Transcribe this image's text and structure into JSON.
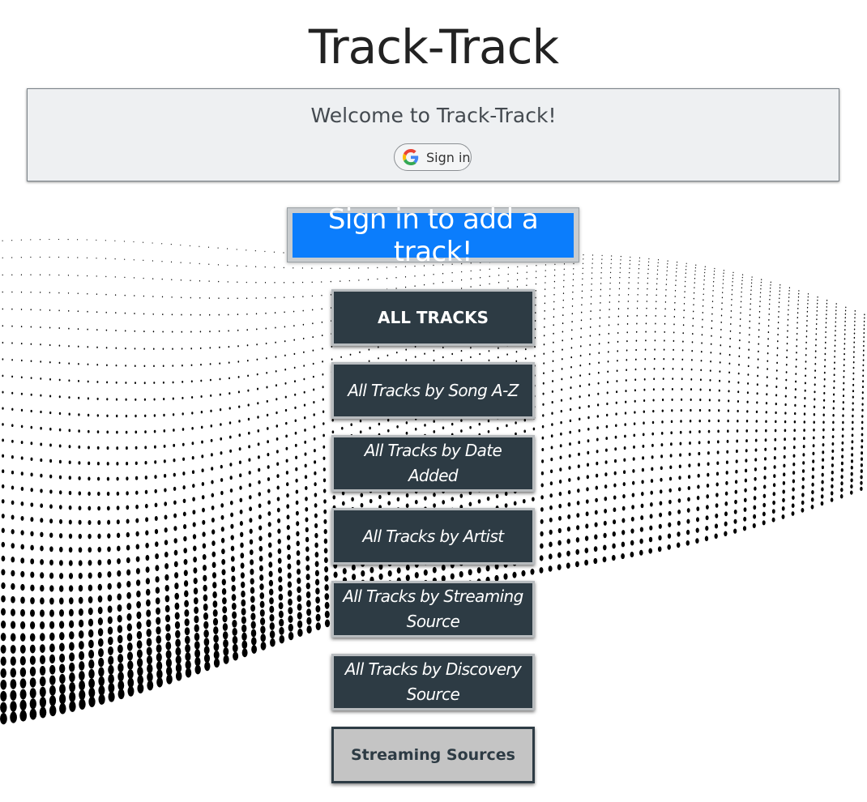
{
  "header": {
    "title": "Track-Track"
  },
  "welcome": {
    "message": "Welcome to Track-Track!",
    "google_signin_label": "Sign in",
    "google_icon": "google-g-icon"
  },
  "add_track": {
    "label": "Sign in to add a track!"
  },
  "nav": {
    "buttons": [
      {
        "label": "ALL TRACKS"
      },
      {
        "label": "All Tracks by Song A-Z"
      },
      {
        "label": "All Tracks by Date Added"
      },
      {
        "label": "All Tracks by Artist"
      },
      {
        "label": "All Tracks by Streaming Source"
      },
      {
        "label": "All Tracks by Discovery Source"
      },
      {
        "label": "Streaming Sources"
      }
    ]
  },
  "colors": {
    "nav_dark": "#2d3b44",
    "accent_blue": "#0b7dfc",
    "panel_bg": "#eef0f2",
    "streaming_sources_bg": "#c4c4c4"
  },
  "background": {
    "pattern": "halftone-dot-wave"
  }
}
